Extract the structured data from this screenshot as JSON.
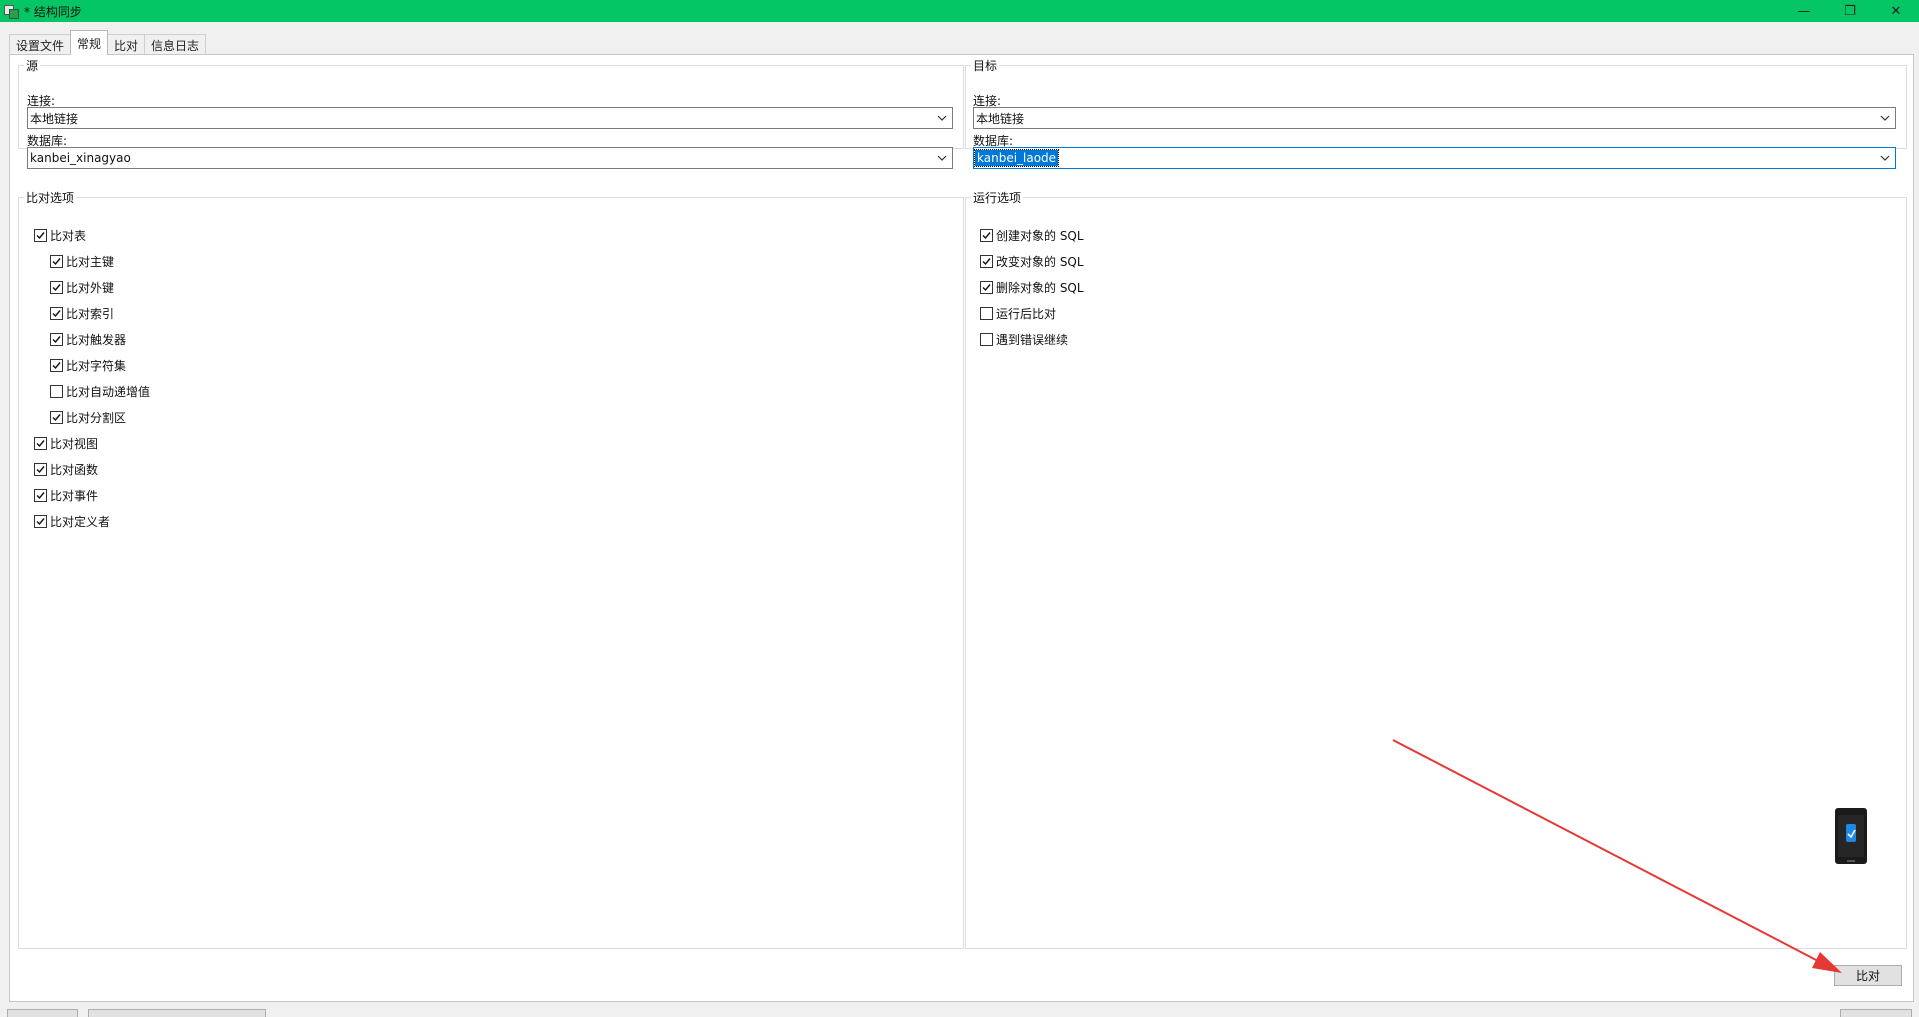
{
  "window": {
    "title": "* 结构同步",
    "controls": {
      "minimize": "—",
      "restore": "❐",
      "close": "✕"
    }
  },
  "tabs": [
    "设置文件",
    "常规",
    "比对",
    "信息日志"
  ],
  "active_tab": 1,
  "source": {
    "legend": "源",
    "connection_label": "连接:",
    "connection_value": "本地链接",
    "database_label": "数据库:",
    "database_value": "kanbei_xinagyao"
  },
  "target": {
    "legend": "目标",
    "connection_label": "连接:",
    "connection_value": "本地链接",
    "database_label": "数据库:",
    "database_value": "kanbei_laode"
  },
  "compare_options": {
    "legend": "比对选项",
    "items": [
      {
        "label": "比对表",
        "checked": true,
        "level": 0
      },
      {
        "label": "比对主键",
        "checked": true,
        "level": 1
      },
      {
        "label": "比对外键",
        "checked": true,
        "level": 1
      },
      {
        "label": "比对索引",
        "checked": true,
        "level": 1
      },
      {
        "label": "比对触发器",
        "checked": true,
        "level": 1
      },
      {
        "label": "比对字符集",
        "checked": true,
        "level": 1
      },
      {
        "label": "比对自动递增值",
        "checked": false,
        "level": 1
      },
      {
        "label": "比对分割区",
        "checked": true,
        "level": 1
      },
      {
        "label": "比对视图",
        "checked": true,
        "level": 0
      },
      {
        "label": "比对函数",
        "checked": true,
        "level": 0
      },
      {
        "label": "比对事件",
        "checked": true,
        "level": 0
      },
      {
        "label": "比对定义者",
        "checked": true,
        "level": 0
      }
    ]
  },
  "run_options": {
    "legend": "运行选项",
    "items": [
      {
        "label": "创建对象的 SQL",
        "checked": true
      },
      {
        "label": "改变对象的 SQL",
        "checked": true
      },
      {
        "label": "删除对象的 SQL",
        "checked": true
      },
      {
        "label": "运行后比对",
        "checked": false
      },
      {
        "label": "遇到错误继续",
        "checked": false
      }
    ]
  },
  "compare_button": "比对",
  "colors": {
    "titlebar": "#05c665",
    "annotation_arrow": "#e53935",
    "selection": "#0078d7"
  }
}
